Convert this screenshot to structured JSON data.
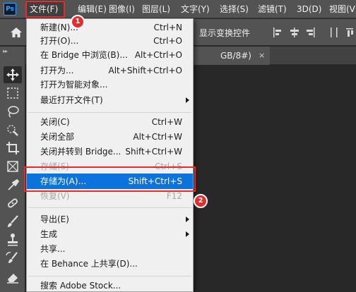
{
  "app": {
    "logo": "Ps"
  },
  "menubar": {
    "items": [
      "文件(F)",
      "编辑(E)",
      "图像(I)",
      "图层(L)",
      "文字(Y)",
      "选择(S)",
      "滤镜(T)",
      "3D(D)",
      "视图(V)"
    ]
  },
  "options_bar": {
    "show_transform_label": "显示变换控件"
  },
  "document": {
    "tab_label": "GB/8#)",
    "close_glyph": "×"
  },
  "file_menu": {
    "items": [
      {
        "label": "新建(N)...",
        "shortcut": "Ctrl+N"
      },
      {
        "label": "打开(O)...",
        "shortcut": "Ctrl+O"
      },
      {
        "label": "在 Bridge 中浏览(B)...",
        "shortcut": "Alt+Ctrl+O"
      },
      {
        "label": "打开为...",
        "shortcut": "Alt+Shift+Ctrl+O"
      },
      {
        "label": "打开为智能对象...",
        "shortcut": ""
      },
      {
        "label": "最近打开文件(T)",
        "shortcut": ""
      },
      {
        "label": "关闭(C)",
        "shortcut": "Ctrl+W"
      },
      {
        "label": "关闭全部",
        "shortcut": "Alt+Ctrl+W"
      },
      {
        "label": "关闭并转到 Bridge...",
        "shortcut": "Shift+Ctrl+W"
      },
      {
        "label": "存储(S)",
        "shortcut": "Ctrl+S"
      },
      {
        "label": "存储为(A)...",
        "shortcut": "Shift+Ctrl+S"
      },
      {
        "label": "恢复(V)",
        "shortcut": "F12"
      },
      {
        "label": "导出(E)",
        "shortcut": ""
      },
      {
        "label": "生成",
        "shortcut": ""
      },
      {
        "label": "共享...",
        "shortcut": ""
      },
      {
        "label": "在 Behance 上共享(D)...",
        "shortcut": ""
      },
      {
        "label": "搜索 Adobe Stock...",
        "shortcut": ""
      }
    ]
  },
  "annotations": {
    "step1": "1",
    "step2": "2"
  },
  "colors": {
    "accent": "#0b73d9",
    "highlight_box": "#e52b2b",
    "logo": "#31a8ff"
  }
}
